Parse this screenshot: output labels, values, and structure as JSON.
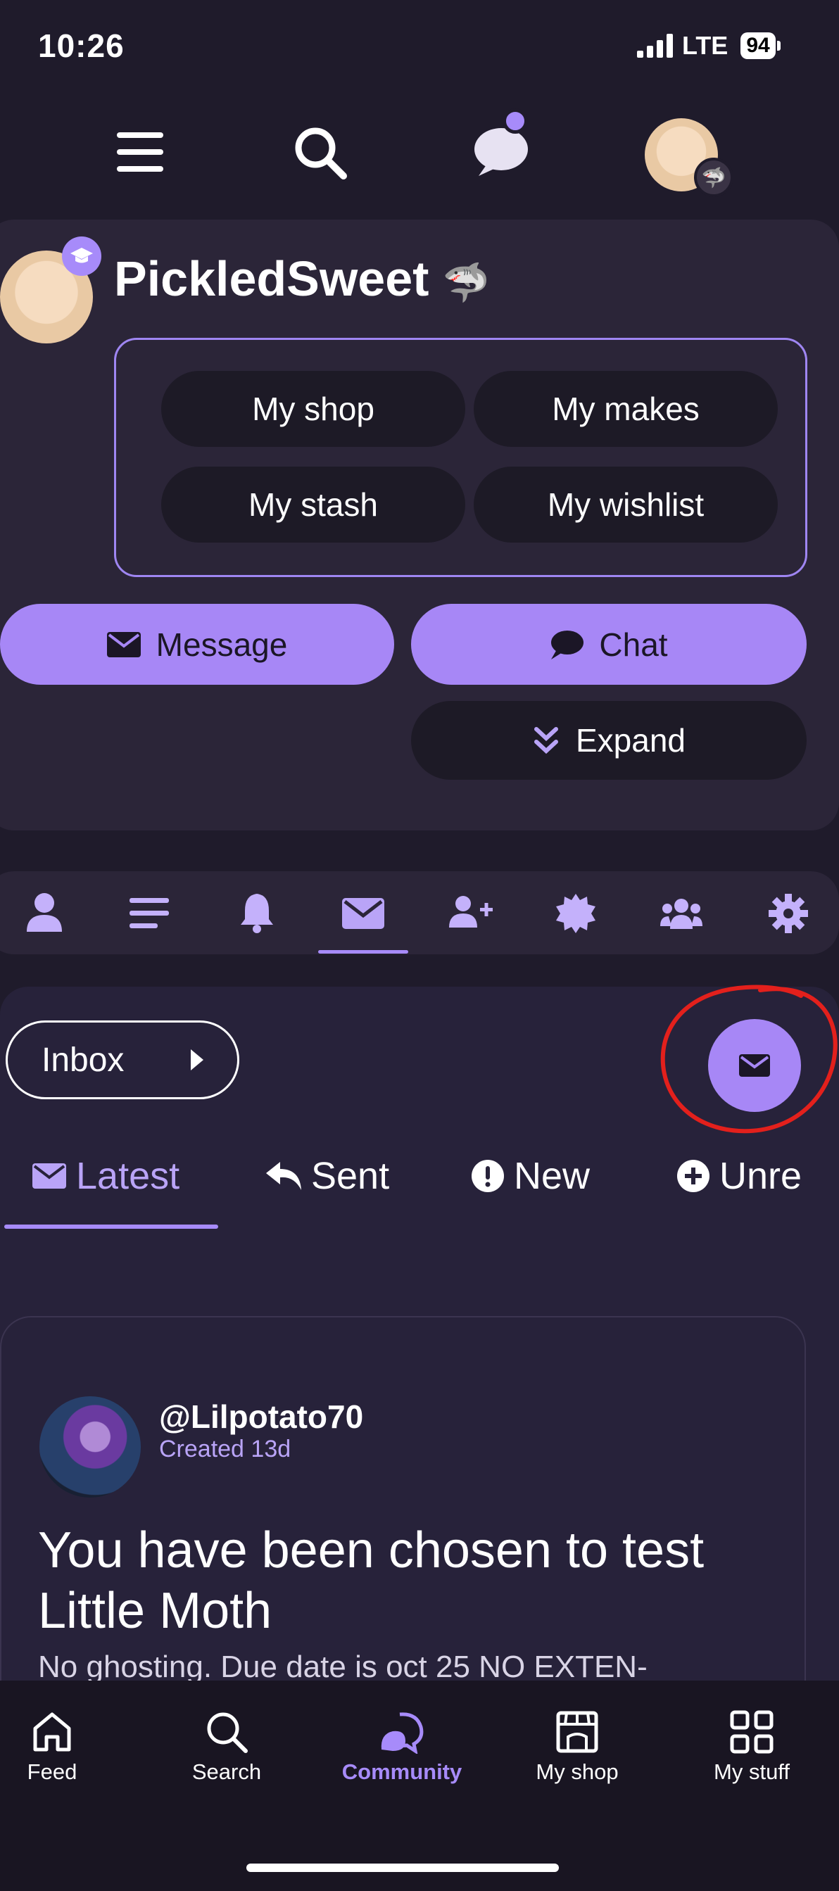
{
  "status_bar": {
    "time": "10:26",
    "network": "LTE",
    "battery": "94"
  },
  "profile": {
    "name": "PickledSweet",
    "links": [
      "My shop",
      "My makes",
      "My stash",
      "My wishlist"
    ],
    "actions": {
      "message": "Message",
      "chat": "Chat",
      "expand": "Expand"
    }
  },
  "messages": {
    "folder_label": "Inbox",
    "filters": [
      "Latest",
      "Sent",
      "New",
      "Unre"
    ],
    "card": {
      "sender": "@Lilpotato70",
      "created": "Created 13d",
      "title": "You have been chosen to test Little Moth",
      "preview": "No ghosting. Due date is oct 25 NO EXTEN-"
    }
  },
  "bottom_nav": [
    "Feed",
    "Search",
    "Community",
    "My shop",
    "My stuff"
  ],
  "colors": {
    "accent": "#a78bfa",
    "background": "#1f1b2b",
    "card": "#2b2538",
    "annotation": "#e3201c"
  }
}
